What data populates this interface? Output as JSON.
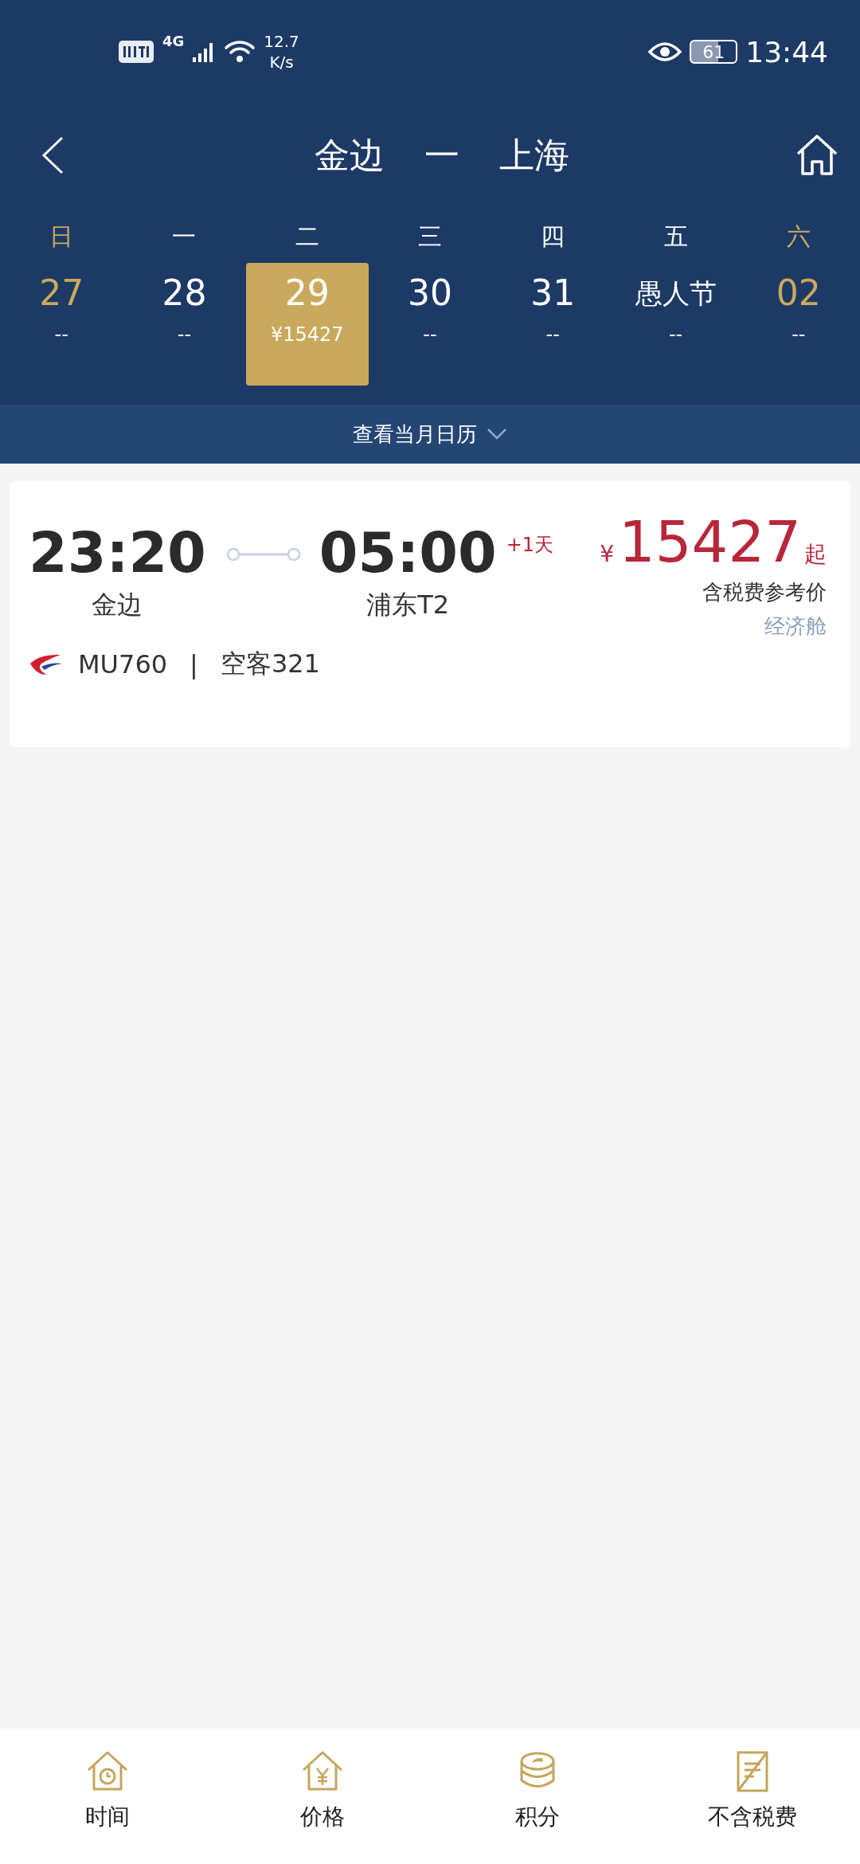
{
  "status_bar": {
    "network": "4G",
    "speed_value": "12.7",
    "speed_unit": "K/s",
    "battery": "61",
    "time": "13:44"
  },
  "header": {
    "origin": "金边",
    "separator": "一",
    "destination": "上海"
  },
  "days": [
    {
      "weekday": "日",
      "date": "27",
      "price": "--",
      "weekend": true,
      "selected": false
    },
    {
      "weekday": "一",
      "date": "28",
      "price": "--",
      "weekend": false,
      "selected": false
    },
    {
      "weekday": "二",
      "date": "29",
      "price": "¥15427",
      "weekend": false,
      "selected": true
    },
    {
      "weekday": "三",
      "date": "30",
      "price": "--",
      "weekend": false,
      "selected": false
    },
    {
      "weekday": "四",
      "date": "31",
      "price": "--",
      "weekend": false,
      "selected": false
    },
    {
      "weekday": "五",
      "date": "愚人节",
      "price": "--",
      "weekend": false,
      "selected": false
    },
    {
      "weekday": "六",
      "date": "02",
      "price": "--",
      "weekend": true,
      "selected": false
    }
  ],
  "calendar_link": "查看当月日历",
  "flights": [
    {
      "depart_time": "23:20",
      "depart_airport": "金边",
      "arrive_time": "05:00",
      "day_offset": "+1天",
      "arrive_airport": "浦东T2",
      "currency": "¥",
      "price": "15427",
      "price_suffix": "起",
      "price_note": "含税费参考价",
      "cabin": "经济舱",
      "flight_no": "MU760",
      "divider": "|",
      "aircraft": "空客321"
    }
  ],
  "tabs": [
    {
      "kind": "time",
      "label": "时间"
    },
    {
      "kind": "price",
      "label": "价格"
    },
    {
      "kind": "points",
      "label": "积分"
    },
    {
      "kind": "tax",
      "label": "不含税费"
    }
  ]
}
